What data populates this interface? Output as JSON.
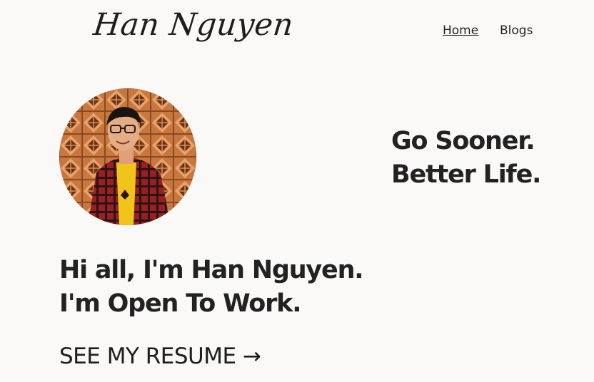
{
  "header": {
    "logo_text": "Han Nguyen",
    "nav": [
      {
        "label": "Home",
        "active": true
      },
      {
        "label": "Blogs",
        "active": false
      }
    ]
  },
  "hero": {
    "avatar": {
      "icon": "profile-photo"
    },
    "tagline": [
      "Go Sooner.",
      "Better Life."
    ],
    "headline": [
      "Hi all, I'm Han Nguyen.",
      "I'm Open To Work."
    ],
    "cta": "SEE MY RESUME →"
  },
  "colors": {
    "background": "#faf9f8",
    "text": "#222222",
    "photo_wall": "#c8773e",
    "shirt_red": "#9a1f23",
    "shirt_yellow": "#f0c419"
  }
}
